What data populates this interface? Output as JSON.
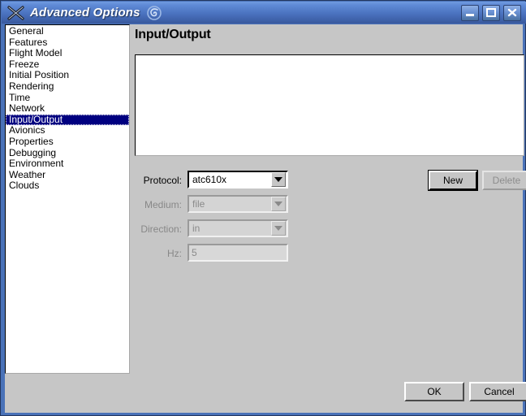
{
  "window": {
    "title": "Advanced Options",
    "app_icon": "x-cross-icon",
    "title_badge_icon": "spiral-swirl-icon",
    "frame_color": "#4a72b8",
    "titlebar_gradient_top": "#6f9be0",
    "titlebar_gradient_bottom": "#39599d",
    "client_background": "#c6c6c6",
    "controls": {
      "minimize_label": "_",
      "maximize_label": "□",
      "close_label": "✕"
    }
  },
  "sidebar": {
    "selected_index": 8,
    "selection_color": "#000080",
    "items": [
      {
        "label": "General"
      },
      {
        "label": "Features"
      },
      {
        "label": "Flight Model"
      },
      {
        "label": "Freeze"
      },
      {
        "label": "Initial Position"
      },
      {
        "label": "Rendering"
      },
      {
        "label": "Time"
      },
      {
        "label": "Network"
      },
      {
        "label": "Input/Output"
      },
      {
        "label": "Avionics"
      },
      {
        "label": "Properties"
      },
      {
        "label": "Debugging"
      },
      {
        "label": "Environment"
      },
      {
        "label": "Weather"
      },
      {
        "label": "Clouds"
      }
    ]
  },
  "panel": {
    "title": "Input/Output",
    "io_list": {
      "items": [],
      "empty": true
    },
    "form": {
      "protocol": {
        "label": "Protocol:",
        "value": "atc610x",
        "enabled": true
      },
      "medium": {
        "label": "Medium:",
        "value": "file",
        "enabled": false
      },
      "direction": {
        "label": "Direction:",
        "value": "in",
        "enabled": false
      },
      "hz": {
        "label": "Hz:",
        "value": "5",
        "enabled": false
      }
    },
    "actions": {
      "new_label": "New",
      "new_enabled": true,
      "delete_label": "Delete",
      "delete_enabled": false
    }
  },
  "footer": {
    "ok_label": "OK",
    "cancel_label": "Cancel"
  }
}
